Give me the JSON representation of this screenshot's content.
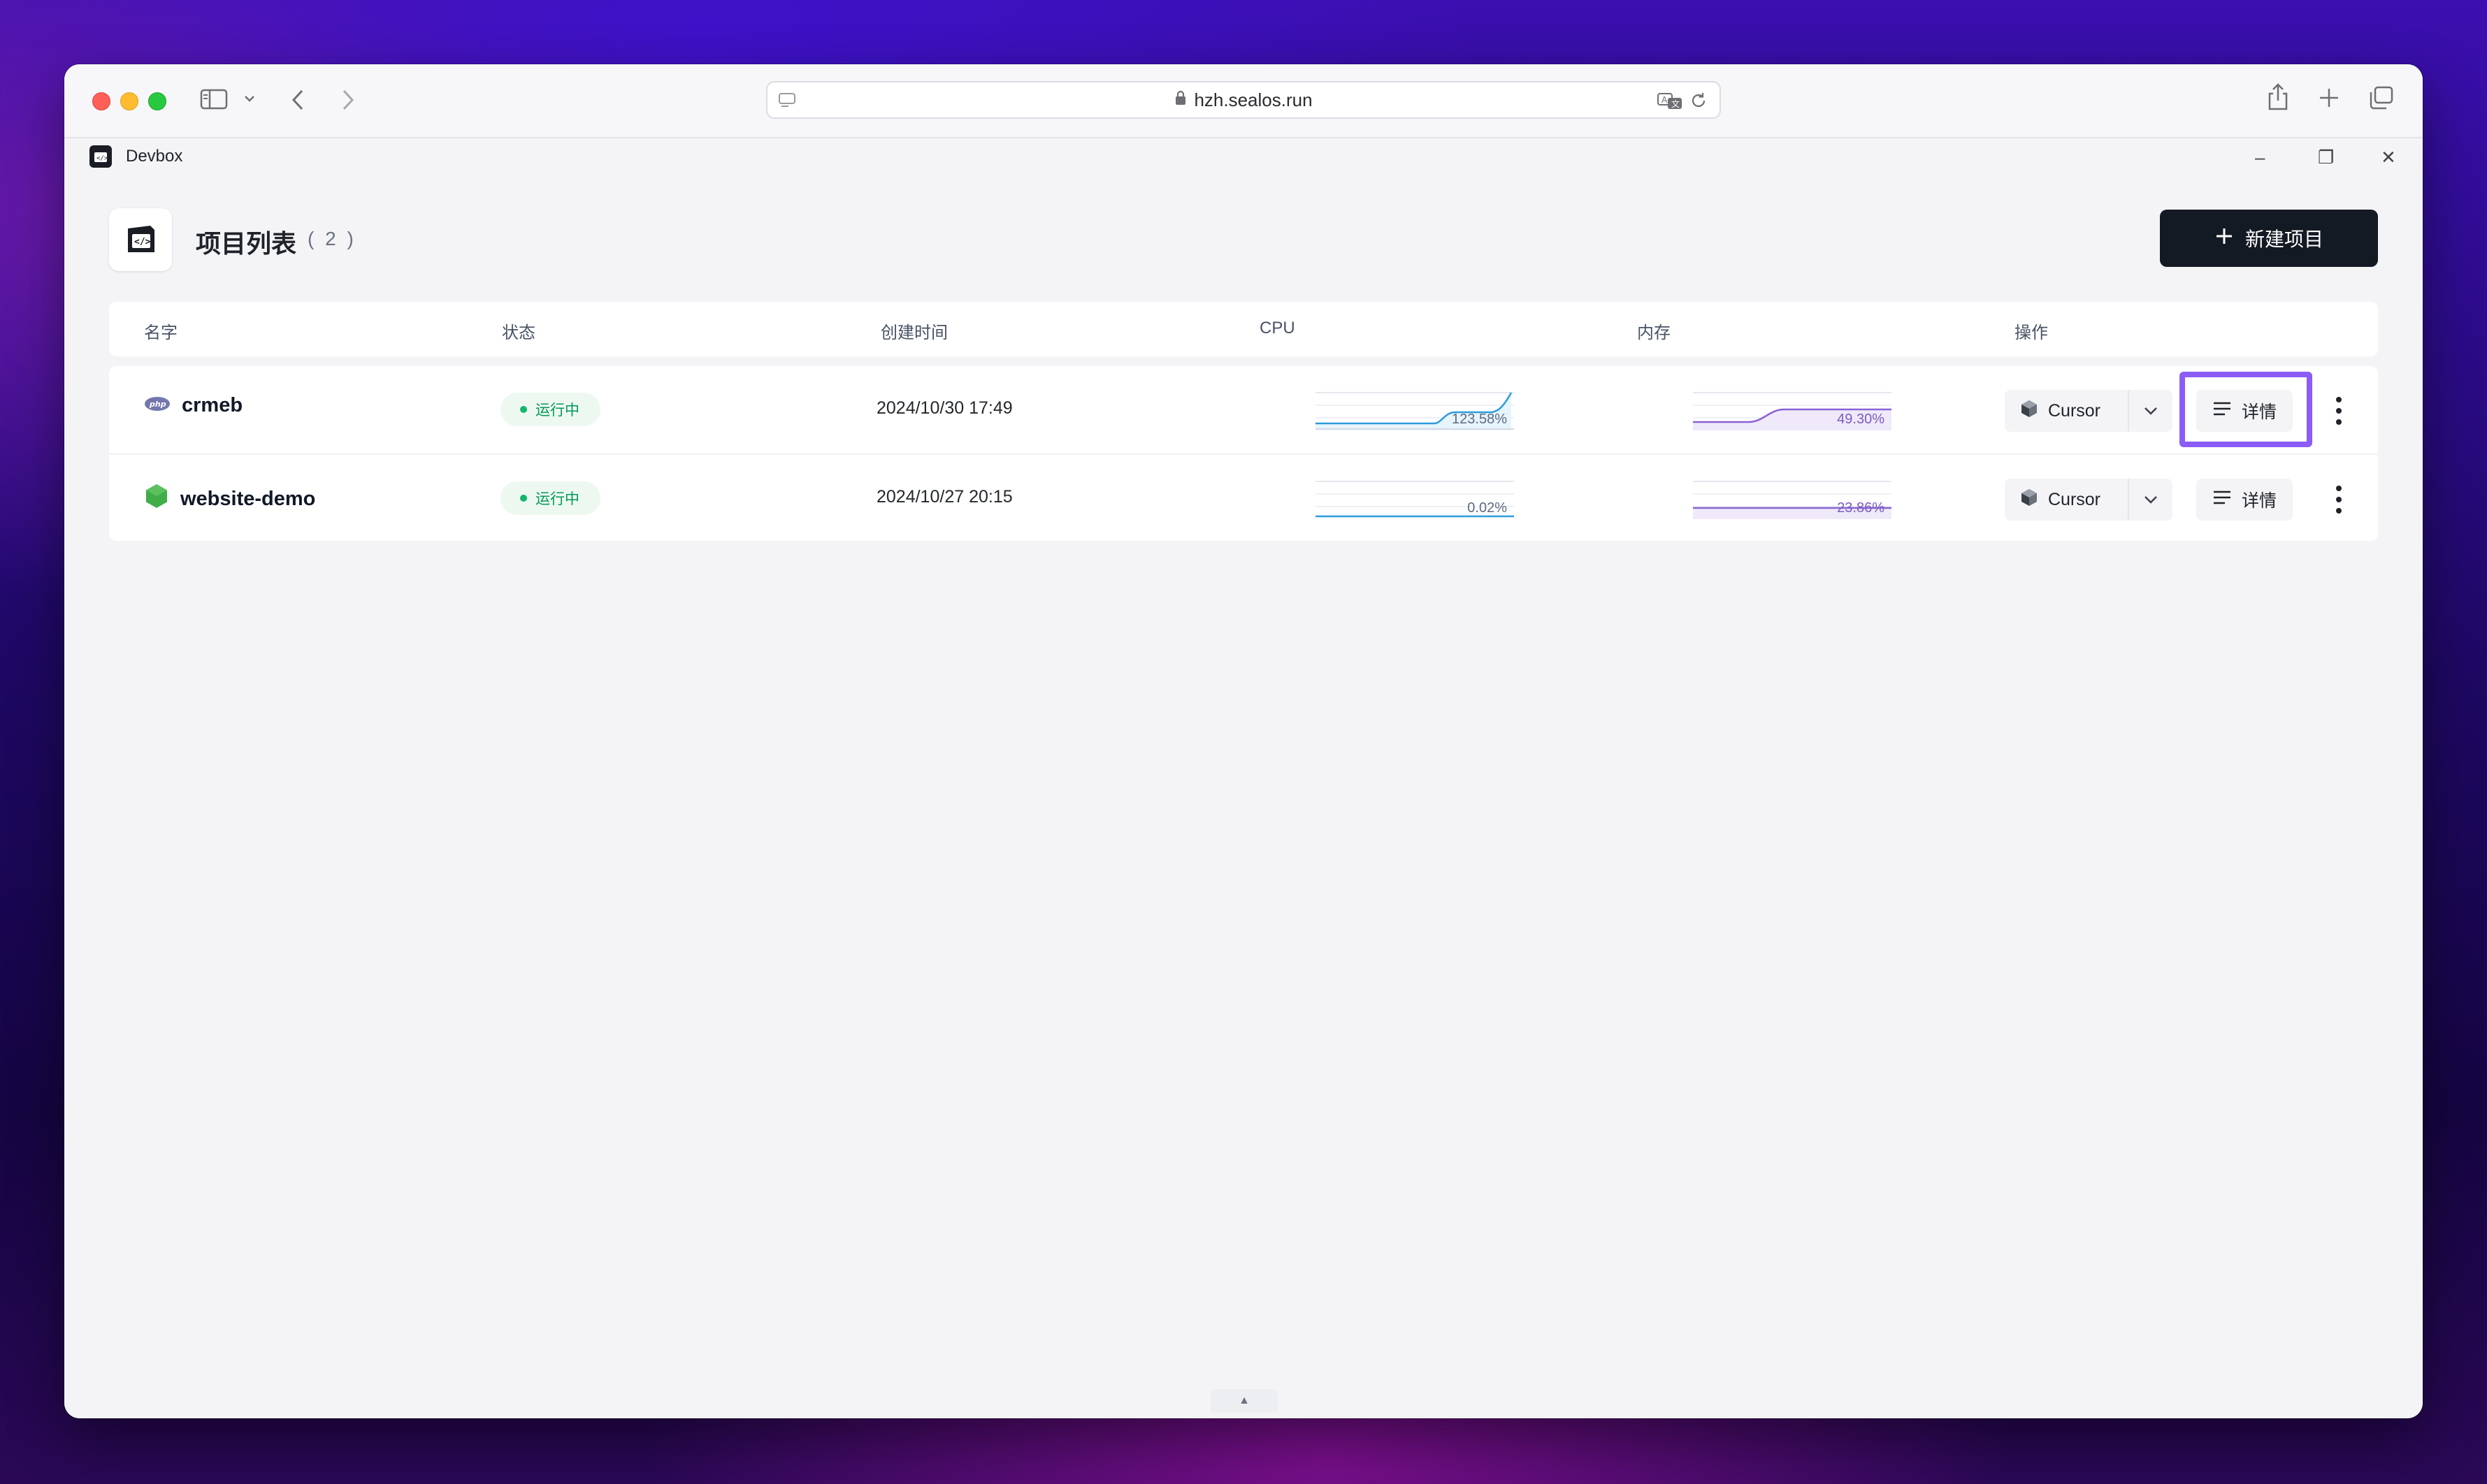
{
  "browser": {
    "url": "hzh.sealos.run"
  },
  "app": {
    "title": "Devbox",
    "window_controls": [
      "–",
      "❐",
      "✕"
    ]
  },
  "page": {
    "title": "项目列表",
    "count": "( 2 )",
    "new_button": "新建项目"
  },
  "table": {
    "headers": {
      "name": "名字",
      "status": "状态",
      "created": "创建时间",
      "cpu": "CPU",
      "memory": "内存",
      "actions": "操作"
    },
    "rows": [
      {
        "name": "crmeb",
        "icon": "php-icon",
        "status": "运行中",
        "created": "2024/10/30 17:49",
        "cpu": "123.58%",
        "memory": "49.30%",
        "ide": "Cursor",
        "detail": "详情"
      },
      {
        "name": "website-demo",
        "icon": "nodejs-hexagon-icon",
        "status": "运行中",
        "created": "2024/10/27 20:15",
        "cpu": "0.02%",
        "memory": "23.86%",
        "ide": "Cursor",
        "detail": "详情"
      }
    ]
  },
  "colors": {
    "status_green": "#12b76a",
    "cpu_line": "#2d9cdb",
    "memory_line": "#8a63d2",
    "highlight": "#8b5cf6",
    "primary_button": "#141a24"
  }
}
